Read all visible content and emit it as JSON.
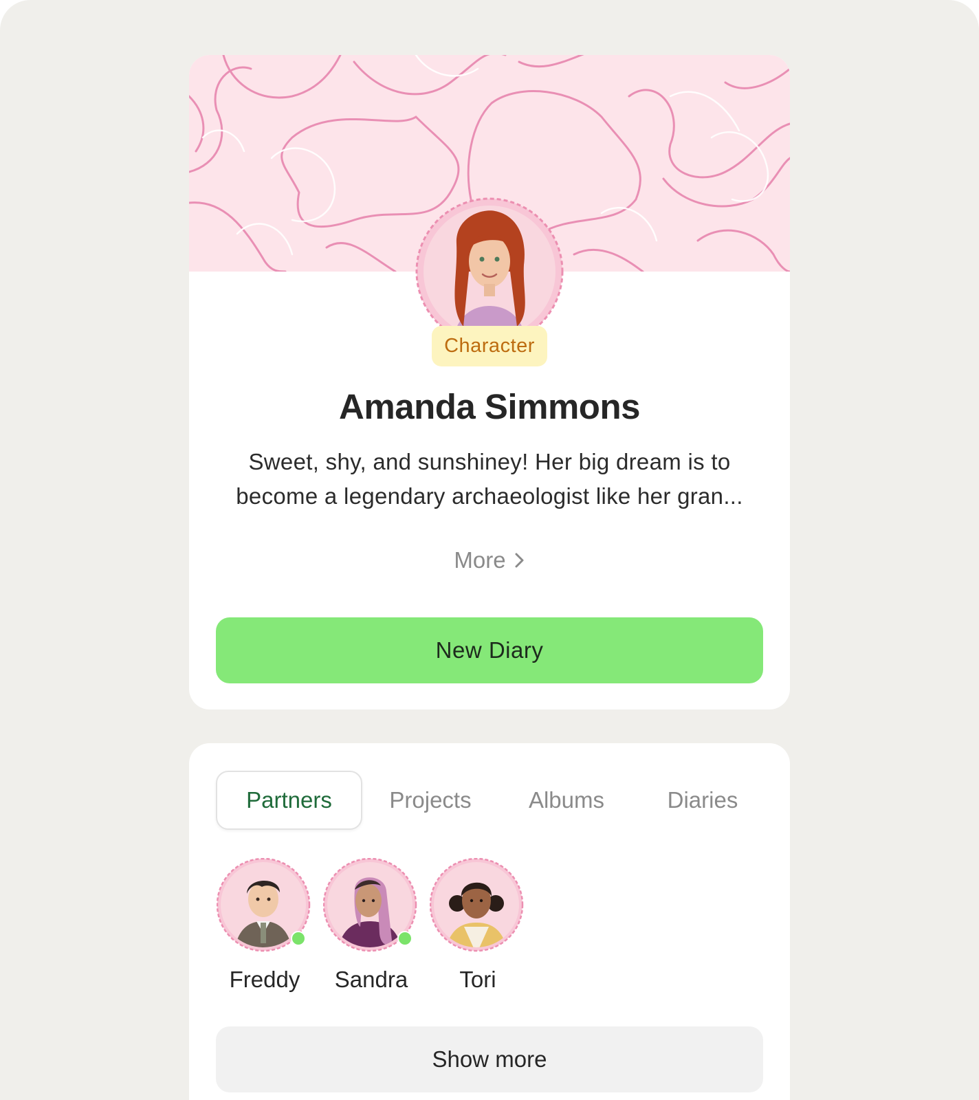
{
  "profile": {
    "role_badge": "Character",
    "name": "Amanda Simmons",
    "bio": "Sweet, shy, and sunshiney! Her big dream is to become a legendary archaeologist like her gran...",
    "more_label": "More",
    "new_diary_label": "New Diary",
    "avatar_icon": "character-portrait-icon"
  },
  "tabs": [
    {
      "label": "Partners",
      "active": true
    },
    {
      "label": "Projects",
      "active": false
    },
    {
      "label": "Albums",
      "active": false
    },
    {
      "label": "Diaries",
      "active": false
    }
  ],
  "partners": [
    {
      "name": "Freddy",
      "online": true
    },
    {
      "name": "Sandra",
      "online": true
    },
    {
      "name": "Tori",
      "online": false
    }
  ],
  "show_more_label": "Show more",
  "colors": {
    "page_background": "#f0efeb",
    "accent_green": "#85e878",
    "cover_pink": "#fde4ea",
    "badge_background": "#fdf4bf",
    "badge_text": "#bd6c10",
    "active_tab_text": "#1f6b3a",
    "online_dot": "#7be36a"
  }
}
